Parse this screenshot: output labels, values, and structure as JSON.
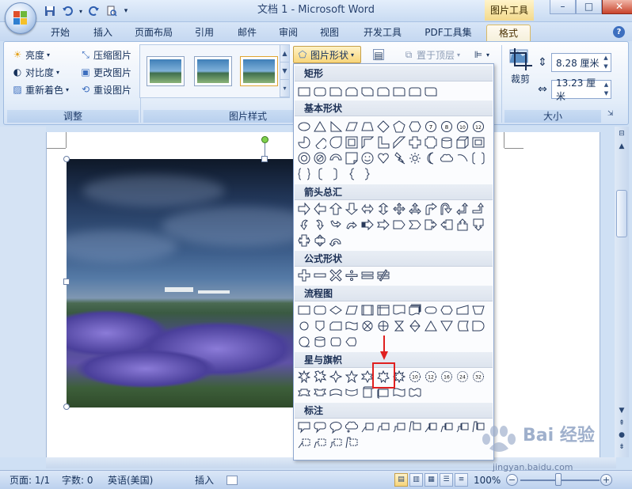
{
  "window": {
    "title": "文档 1 - Microsoft Word",
    "context_tab_group": "图片工具",
    "min": "–",
    "max": "□",
    "close": "✕"
  },
  "ribbon_tabs": [
    {
      "label": "开始",
      "active": false
    },
    {
      "label": "插入",
      "active": false
    },
    {
      "label": "页面布局",
      "active": false
    },
    {
      "label": "引用",
      "active": false
    },
    {
      "label": "邮件",
      "active": false
    },
    {
      "label": "审阅",
      "active": false
    },
    {
      "label": "视图",
      "active": false
    },
    {
      "label": "开发工具",
      "active": false
    },
    {
      "label": "PDF工具集",
      "active": false
    },
    {
      "label": "格式",
      "active": true
    }
  ],
  "adjust_group": {
    "label": "调整",
    "brightness": "亮度",
    "contrast": "对比度",
    "recolor": "重新着色",
    "compress": "压缩图片",
    "change_picture": "更改图片",
    "reset_picture": "重设图片"
  },
  "picture_styles_group": {
    "label": "图片样式",
    "shape_button": "图片形状"
  },
  "arrange_group": {
    "bring_front": "置于顶层"
  },
  "size_group": {
    "label": "大小",
    "crop": "裁剪",
    "height": "8.28 厘米",
    "width": "13.23 厘米"
  },
  "shape_gallery": {
    "categories": [
      {
        "name": "矩形",
        "rows": 1
      },
      {
        "name": "基本形状",
        "rows": 4
      },
      {
        "name": "箭头总汇",
        "rows": 3
      },
      {
        "name": "公式形状",
        "rows": 1
      },
      {
        "name": "流程图",
        "rows": 3
      },
      {
        "name": "星与旗帜",
        "rows": 2
      },
      {
        "name": "标注",
        "rows": 2
      }
    ]
  },
  "status_bar": {
    "page": "页面: 1/1",
    "words": "字数: 0",
    "language": "英语(美国)",
    "mode": "插入",
    "zoom": "100%"
  },
  "watermark": {
    "text": "Bai 经验",
    "sub": "jingyan.baidu.com"
  },
  "colors": {
    "ribbon_bg": "#e3edf9",
    "active_tab": "#f5f0dc",
    "highlight": "#e02020",
    "rotation_handle": "#7ed04b"
  }
}
